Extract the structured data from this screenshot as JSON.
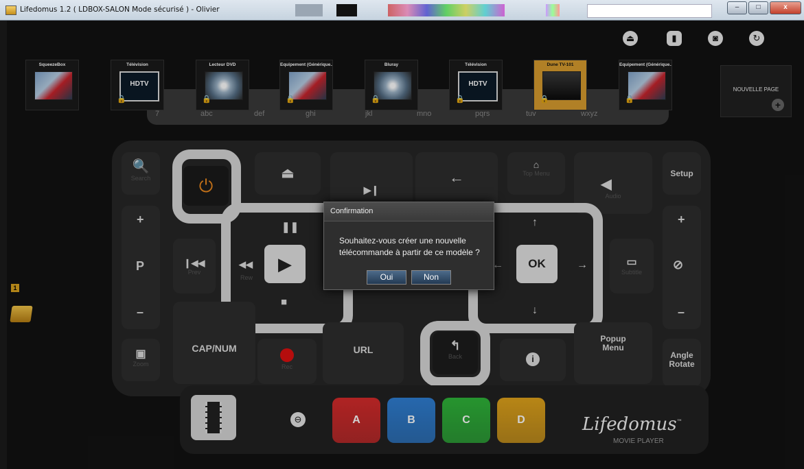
{
  "window": {
    "title": "Lifedomus 1.2 ( LDBOX-SALON Mode sécurisé ) - Olivier",
    "minimize": "–",
    "maximize": "□",
    "close": "x"
  },
  "header": {
    "icons": [
      "eject-icon",
      "remote-icon",
      "device-icon",
      "refresh-icon"
    ]
  },
  "devices": [
    {
      "label": "SqueezeBox",
      "image": "knife",
      "locked": false,
      "active": false
    },
    {
      "label": "Télévision",
      "image": "tv",
      "image_text": "HDTV",
      "locked": true,
      "active": false
    },
    {
      "label": "Lecteur DVD",
      "image": "dvd",
      "locked": true,
      "active": false
    },
    {
      "label": "Equipement (Générique...",
      "image": "knife",
      "locked": true,
      "active": false
    },
    {
      "label": "Bluray",
      "image": "dvd",
      "locked": true,
      "active": false
    },
    {
      "label": "Télévision",
      "image": "tv",
      "image_text": "HDTV",
      "locked": true,
      "active": false
    },
    {
      "label": "Dune TV-101",
      "image": "box",
      "locked": true,
      "active": true
    },
    {
      "label": "Equipement (Générique...",
      "image": "knife",
      "locked": true,
      "active": false
    }
  ],
  "new_page": {
    "label": "NOUVELLE PAGE",
    "plus": "+"
  },
  "keypad": [
    "7",
    "abc",
    "def",
    "ghi",
    "jkl",
    "mno",
    "pqrs",
    "tuv",
    "wxyz"
  ],
  "remote": {
    "search": "Search",
    "setup": "Setup",
    "plus": "+",
    "minus": "–",
    "p": "P",
    "prev": "Prev",
    "rew": "Rew",
    "zoom": "Zoom",
    "capnum": "CAP/NUM",
    "rec": "Rec",
    "url": "URL",
    "back": "Back",
    "top_menu": "Top Menu",
    "audio": "Audio",
    "subtitle": "Subtitle",
    "popup_menu": "Popup\nMenu",
    "angle_rotate": "Angle\nRotate",
    "ok": "OK"
  },
  "color_buttons": [
    {
      "label": "A",
      "color": "#d62b2b"
    },
    {
      "label": "B",
      "color": "#2f7fd4"
    },
    {
      "label": "C",
      "color": "#2fb53a"
    },
    {
      "label": "D",
      "color": "#e0a31c"
    }
  ],
  "brand": {
    "name": "Lifedomus",
    "tm": "™",
    "sub": "MOVIE PLAYER"
  },
  "sidebar": {
    "folder_badge": "1"
  },
  "dialog": {
    "title": "Confirmation",
    "message": "Souhaitez-vous créer une nouvelle télécommande à partir de ce modèle ?",
    "yes": "Oui",
    "no": "Non"
  }
}
